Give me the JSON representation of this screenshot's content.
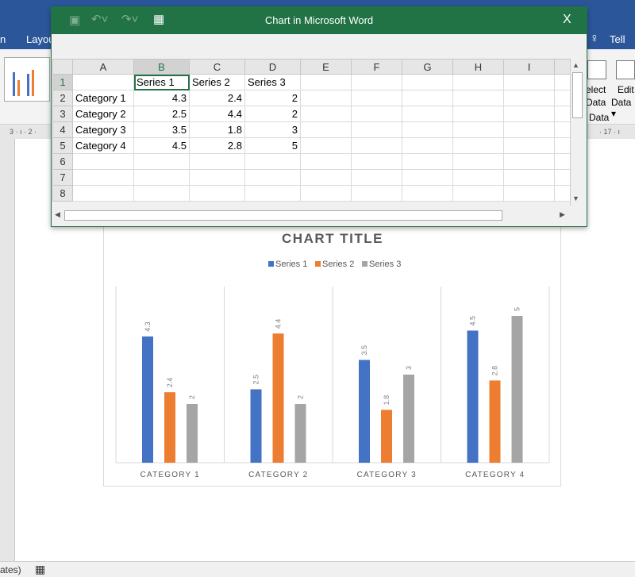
{
  "word": {
    "tabs": [
      "n",
      "Layou"
    ],
    "tell_me": "Tell m",
    "ribbon": {
      "select_data": [
        "elect",
        "Data"
      ],
      "edit_data": [
        "Edit",
        "Data ▾"
      ],
      "group_label": "Data"
    },
    "ruler_left": "3 · ı · 2 ·",
    "ruler_right": "· 17 · ı",
    "status_text": "ates)"
  },
  "excel": {
    "title": "Chart in Microsoft Word",
    "close": "X",
    "columns": [
      "A",
      "B",
      "C",
      "D",
      "E",
      "F",
      "G",
      "H",
      "I"
    ],
    "rows": [
      [
        "",
        "Series 1",
        "Series 2",
        "Series 3"
      ],
      [
        "Category 1",
        "4.3",
        "2.4",
        "2"
      ],
      [
        "Category 2",
        "2.5",
        "4.4",
        "2"
      ],
      [
        "Category 3",
        "3.5",
        "1.8",
        "3"
      ],
      [
        "Category 4",
        "4.5",
        "2.8",
        "5"
      ],
      [],
      [],
      []
    ],
    "active_cell": "B1"
  },
  "chart_data": {
    "type": "bar",
    "title": "CHART TITLE",
    "categories": [
      "CATEGORY 1",
      "CATEGORY 2",
      "CATEGORY 3",
      "CATEGORY 4"
    ],
    "series": [
      {
        "name": "Series 1",
        "values": [
          4.3,
          2.5,
          3.5,
          4.5
        ],
        "color": "#4472c4"
      },
      {
        "name": "Series 2",
        "values": [
          2.4,
          4.4,
          1.8,
          2.8
        ],
        "color": "#ed7d31"
      },
      {
        "name": "Series 3",
        "values": [
          2,
          2,
          3,
          5
        ],
        "color": "#a5a5a5"
      }
    ],
    "ylim": [
      0,
      6
    ],
    "legend": "top",
    "grid": "vertical category separators",
    "data_labels": true
  }
}
